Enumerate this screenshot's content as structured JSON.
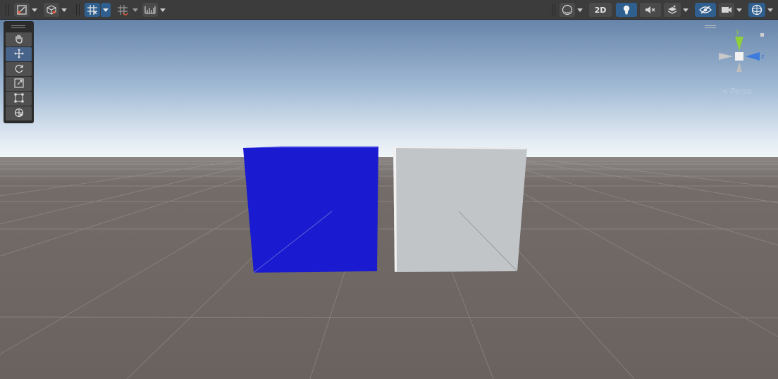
{
  "toolbar": {
    "left_groups": [
      {
        "name": "draw-mode",
        "icon": "shaded-draw-mode-icon"
      },
      {
        "name": "render-paths",
        "icon": "cube-icon"
      },
      {
        "name": "grid-snapping",
        "icon": "grid-snap-icon",
        "active": true
      },
      {
        "name": "increment-snapping",
        "icon": "increment-snap-icon"
      },
      {
        "name": "ruler",
        "icon": "ruler-icon"
      }
    ],
    "right_buttons": [
      {
        "name": "shading-mode",
        "icon": "sphere-shading-icon"
      },
      {
        "name": "2d-toggle",
        "label": "2D"
      },
      {
        "name": "lighting-toggle",
        "icon": "lightbulb-icon",
        "active": true
      },
      {
        "name": "audio-toggle",
        "icon": "audio-mute-icon"
      },
      {
        "name": "effects-toggle",
        "icon": "layers-effects-icon"
      },
      {
        "name": "hidden-objects-toggle",
        "icon": "eye-hidden-icon",
        "active": true
      },
      {
        "name": "camera-settings",
        "icon": "camera-icon"
      },
      {
        "name": "gizmos-toggle",
        "icon": "gizmo-sphere-icon",
        "active": true
      }
    ],
    "label_2d": "2D"
  },
  "tools": [
    {
      "name": "hand-tool",
      "icon": "hand-icon"
    },
    {
      "name": "move-tool",
      "icon": "move-arrows-icon",
      "active": true
    },
    {
      "name": "rotate-tool",
      "icon": "rotate-icon"
    },
    {
      "name": "scale-tool",
      "icon": "scale-icon"
    },
    {
      "name": "rect-tool",
      "icon": "rect-transform-icon"
    },
    {
      "name": "transform-tool",
      "icon": "transform-icon"
    }
  ],
  "gizmo": {
    "axis_y": "y",
    "axis_z": "z",
    "projection": "Persp",
    "colors": {
      "y": "#8ecf3a",
      "z": "#3d7bdc",
      "x_neg": "#c8c8c8"
    }
  },
  "scene": {
    "sky_top": "#6d8bb0",
    "sky_horizon": "#eef4fa",
    "ground": "#6a625e",
    "objects": [
      {
        "name": "blue-cube",
        "color": "#1a1ad0"
      },
      {
        "name": "white-cube",
        "color": "#c3c6c9"
      }
    ]
  }
}
